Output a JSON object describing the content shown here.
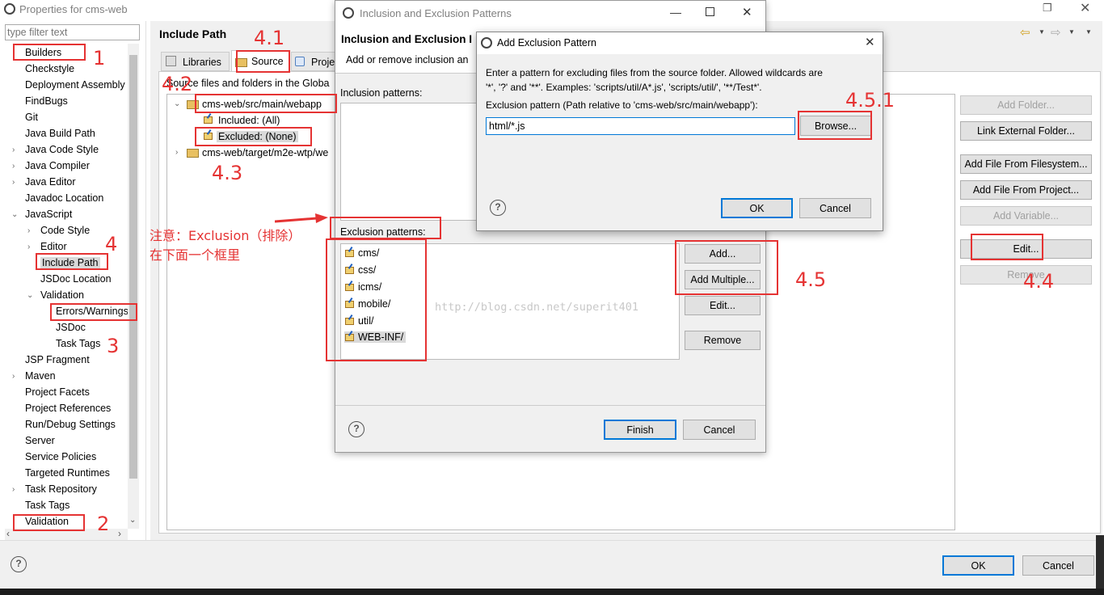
{
  "main_window": {
    "title": "Properties for cms-web",
    "filter_placeholder": "type filter text",
    "page_title": "Include Path",
    "tabs": [
      "Libraries",
      "Source",
      "Proje"
    ],
    "tab_desc": "Source files and folders in the Globa",
    "tree": [
      "Builders",
      "Checkstyle",
      "Deployment Assembly",
      "FindBugs",
      "Git",
      "Java Build Path",
      "Java Code Style",
      "Java Compiler",
      "Java Editor",
      "Javadoc Location",
      "JavaScript",
      "Code Style",
      "Editor",
      "Include Path",
      "JSDoc Location",
      "Validation",
      "Errors/Warnings",
      "JSDoc",
      "Task Tags",
      "JSP Fragment",
      "Maven",
      "Project Facets",
      "Project References",
      "Run/Debug Settings",
      "Server",
      "Service Policies",
      "Targeted Runtimes",
      "Task Repository",
      "Task Tags",
      "Validation"
    ],
    "source_tree": {
      "folder1": "cms-web/src/main/webapp",
      "included": "Included: (All)",
      "excluded": "Excluded: (None)",
      "folder2": "cms-web/target/m2e-wtp/we"
    },
    "right_buttons": [
      "Add Folder...",
      "Link External Folder...",
      "Add File From Filesystem...",
      "Add File From Project...",
      "Add Variable...",
      "Edit...",
      "Remove"
    ],
    "ok": "OK",
    "cancel": "Cancel"
  },
  "inclusion_dialog": {
    "title": "Inclusion and Exclusion Patterns",
    "heading": "Inclusion and Exclusion I",
    "desc": "Add or remove inclusion an",
    "inclusion_label": "Inclusion patterns:",
    "exclusion_label": "Exclusion patterns:",
    "patterns": [
      "cms/",
      "css/",
      "icms/",
      "mobile/",
      "util/",
      "WEB-INF/"
    ],
    "buttons": [
      "Add...",
      "Add Multiple...",
      "Edit...",
      "Remove"
    ],
    "finish": "Finish",
    "cancel": "Cancel"
  },
  "add_dialog": {
    "title": "Add Exclusion Pattern",
    "desc1": "Enter a pattern for excluding files from the source folder. Allowed wildcards are",
    "desc2": "'*', '?' and '**'. Examples: 'scripts/util/A*.js', 'scripts/util/', '**/Test*'.",
    "label": "Exclusion pattern (Path relative to 'cms-web/src/main/webapp'):",
    "value": "html/*.js",
    "browse": "Browse...",
    "ok": "OK",
    "cancel": "Cancel"
  },
  "annotations": {
    "n1": "1",
    "n2": "2",
    "n3": "3",
    "n4": "4",
    "n41": "4.1",
    "n42": "4.2",
    "n43": "4.3",
    "n44": "4.4",
    "n45": "4.5",
    "n451": "4.5.1",
    "note1": "注意：Exclusion（排除）",
    "note2": "在下面一个框里",
    "watermark": "http://blog.csdn.net/superit401"
  }
}
